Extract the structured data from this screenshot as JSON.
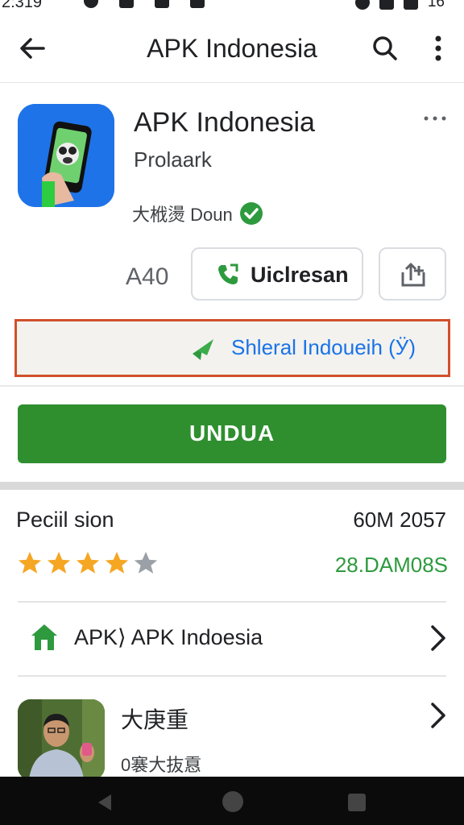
{
  "status_bar": {
    "time": "2:319",
    "battery": "16"
  },
  "app_bar": {
    "title": "APK Indonesia",
    "back_icon": "arrow-left-icon",
    "search_icon": "search-icon",
    "more_icon": "more-vert-icon"
  },
  "app": {
    "name": "APK Indonesia",
    "developer": "Prolaark",
    "tag": "大栰燙 Doun",
    "size": "A40",
    "update_button": "Uiclresan",
    "share_icon": "share-upload-icon",
    "highlight_text": "Shleral Indoueih (Ӱ)",
    "install_button": "UNDUA"
  },
  "info": {
    "title": "Peciil sion",
    "meta": "60M 2057",
    "rating_value": 4,
    "rating_max": 5,
    "green_text": "28.DAM08S"
  },
  "link_row": {
    "label": "APK⟩ APK Indoesia",
    "icon": "home-icon"
  },
  "person_row": {
    "name": "大庚重",
    "subtitle": "0褰大抜慐"
  },
  "colors": {
    "install_green": "#2f8f2f",
    "highlight_border": "#d0502a",
    "link_blue": "#1a73e8",
    "star_orange": "#f5a623"
  }
}
